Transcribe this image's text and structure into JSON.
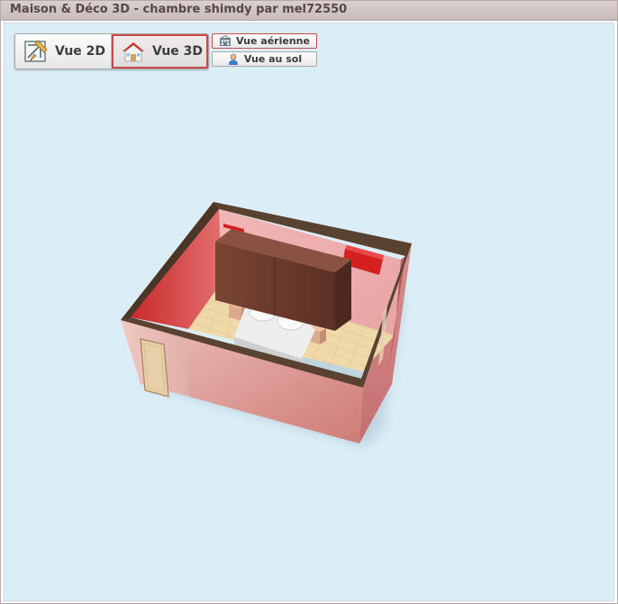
{
  "window": {
    "title": "Maison & Déco 3D - chambre shimdy par mel72550"
  },
  "toolbar": {
    "view_2d_label": "Vue 2D",
    "view_3d_label": "Vue 3D",
    "active_view": "Vue 3D",
    "view_2d_icon": "drafting-plan-icon",
    "view_3d_icon": "house-icon"
  },
  "camera": {
    "aerial_label": "Vue aérienne",
    "ground_label": "Vue au sol",
    "active_camera": "Vue aérienne",
    "aerial_icon": "aerial-view-icon",
    "ground_icon": "person-icon"
  },
  "scene": {
    "room": "chambre",
    "objects": [
      "wardrobe",
      "double-bed",
      "nightstand-left",
      "nightstand-right",
      "wall-radiator",
      "door"
    ]
  },
  "colors": {
    "viewport_bg": "#dbeef8",
    "active_border": "#c84a4a",
    "wall_red": "#d23a3a",
    "floor_wood": "#f0d9a8",
    "wardrobe_brown": "#6b3a2c"
  }
}
